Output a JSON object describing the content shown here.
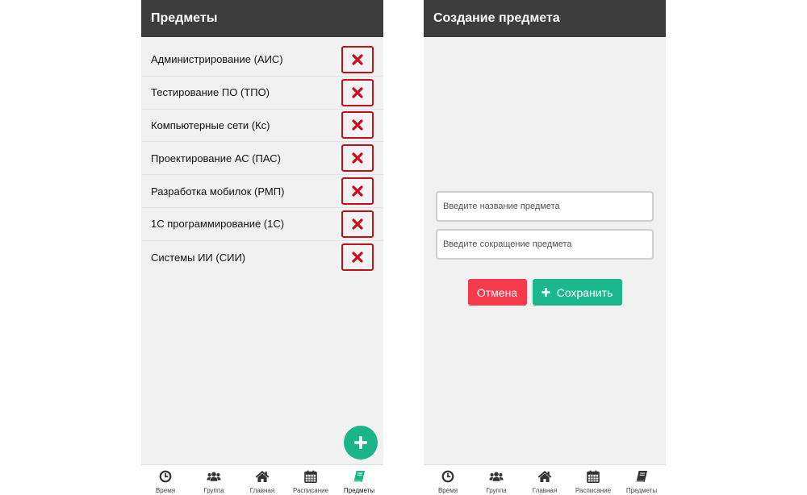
{
  "colors": {
    "appbar": "#3d3d3d",
    "danger": "#c0101a",
    "accent_green": "#19b589",
    "cancel_red": "#f53a4c",
    "background": "#f1f1f1"
  },
  "left_screen": {
    "title": "Предметы",
    "subjects": [
      {
        "name": "Администрирование (АИС)",
        "delete_icon": "close-icon"
      },
      {
        "name": "Тестирование ПО (ТПО)",
        "delete_icon": "close-icon"
      },
      {
        "name": "Компьютерные сети (Кс)",
        "delete_icon": "close-icon"
      },
      {
        "name": "Проектирование АС (ПАС)",
        "delete_icon": "close-icon"
      },
      {
        "name": "Разработка мобилок (РМП)",
        "delete_icon": "close-icon"
      },
      {
        "name": "1С программирование (1С)",
        "delete_icon": "close-icon"
      },
      {
        "name": "Системы ИИ (СИИ)",
        "delete_icon": "close-icon"
      }
    ],
    "fab_icon": "plus-icon",
    "active_nav": "Предметы"
  },
  "right_screen": {
    "title": "Создание предмета",
    "name_placeholder": "Введите название предмета",
    "short_placeholder": "Введите сокращение предмета",
    "cancel_label": "Отмена",
    "save_label": "Сохранить"
  },
  "nav": {
    "items": [
      {
        "label": "Время",
        "icon": "clock-icon"
      },
      {
        "label": "Группа",
        "icon": "users-icon"
      },
      {
        "label": "Главная",
        "icon": "home-icon"
      },
      {
        "label": "Расписание",
        "icon": "calendar-icon"
      },
      {
        "label": "Предметы",
        "icon": "book-icon"
      }
    ]
  }
}
